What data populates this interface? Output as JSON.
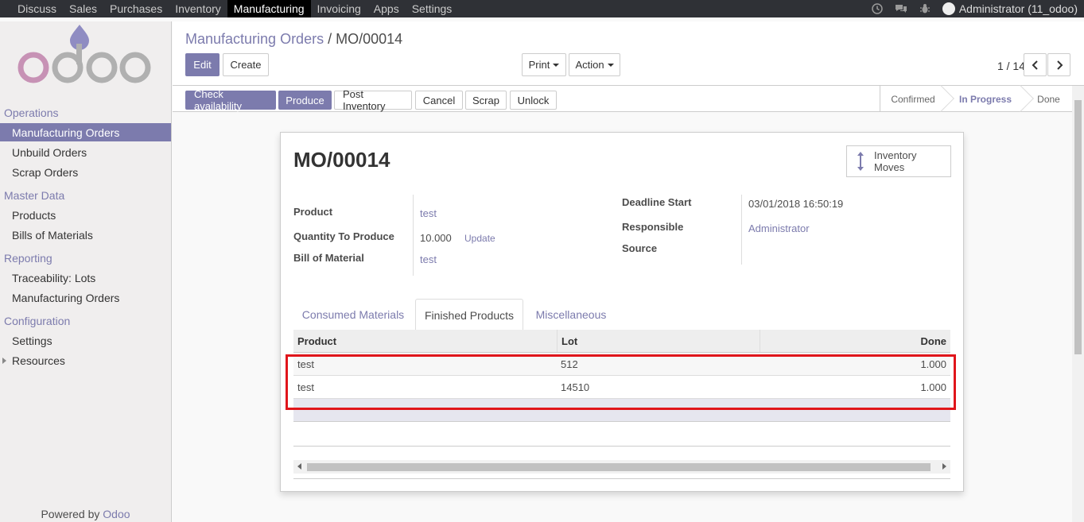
{
  "topbar": {
    "menu": [
      "Discuss",
      "Sales",
      "Purchases",
      "Inventory",
      "Manufacturing",
      "Invoicing",
      "Apps",
      "Settings"
    ],
    "active": "Manufacturing",
    "user": "Administrator (11_odoo)"
  },
  "sidebar": {
    "sections": [
      {
        "title": "Operations",
        "items": [
          "Manufacturing Orders",
          "Unbuild Orders",
          "Scrap Orders"
        ]
      },
      {
        "title": "Master Data",
        "items": [
          "Products",
          "Bills of Materials"
        ]
      },
      {
        "title": "Reporting",
        "items": [
          "Traceability: Lots",
          "Manufacturing Orders"
        ]
      },
      {
        "title": "Configuration",
        "items": [
          "Settings",
          "Resources"
        ]
      }
    ],
    "powered_prefix": "Powered by",
    "powered_brand": "Odoo"
  },
  "control": {
    "breadcrumb_parent": "Manufacturing Orders",
    "breadcrumb_sep": "/",
    "breadcrumb_current": "MO/00014",
    "edit": "Edit",
    "create": "Create",
    "print": "Print",
    "action": "Action",
    "pager": "1 / 14"
  },
  "statusbar": {
    "buttons": [
      "Check availability",
      "Produce",
      "Post Inventory",
      "Cancel",
      "Scrap",
      "Unlock"
    ],
    "stages": [
      "Confirmed",
      "In Progress",
      "Done"
    ],
    "current_stage": "In Progress"
  },
  "sheet": {
    "title": "MO/00014",
    "smart_button": {
      "line1": "Inventory",
      "line2": "Moves"
    },
    "fields": {
      "product_label": "Product",
      "product_value": "test",
      "qty_label": "Quantity To Produce",
      "qty_value": "10.000",
      "qty_action": "Update",
      "bom_label": "Bill of Material",
      "bom_value": "test",
      "deadline_label": "Deadline Start",
      "deadline_value": "03/01/2018 16:50:19",
      "responsible_label": "Responsible",
      "responsible_value": "Administrator",
      "source_label": "Source",
      "source_value": ""
    },
    "tabs": [
      "Consumed Materials",
      "Finished Products",
      "Miscellaneous"
    ],
    "active_tab": "Finished Products",
    "table": {
      "columns": [
        "Product",
        "Lot",
        "Done"
      ],
      "rows": [
        [
          "test",
          "512",
          "1.000"
        ],
        [
          "test",
          "14510",
          "1.000"
        ]
      ]
    }
  }
}
